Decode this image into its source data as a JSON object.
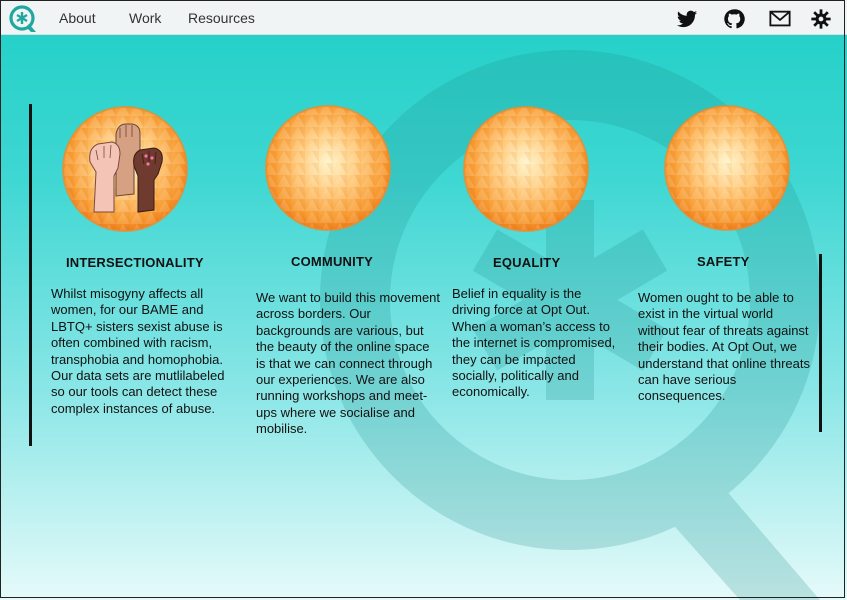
{
  "brand": {
    "logo_icon": "opt-out-asterisk-logo-icon",
    "accent": "#1fa7a0"
  },
  "nav": {
    "links": [
      {
        "label": "About"
      },
      {
        "label": "Work"
      },
      {
        "label": "Resources"
      }
    ],
    "icons": [
      "twitter-icon",
      "github-icon",
      "mail-icon",
      "settings-icon"
    ]
  },
  "values": [
    {
      "title": "INTERSECTIONALITY",
      "text": "Whilst misogyny affects all women, for our BAME and LBTQ+ sisters sexist abuse is often combined with racism, transphobia and homophobia.",
      "text2": "Our data sets are mutlilabeled so our tools can detect these complex instances of abuse.",
      "image": "raised-fists-image"
    },
    {
      "title": "COMMUNITY",
      "text": "We want to build this movement across borders. Our backgrounds are various, but the beauty of the online space is that we can connect through our experiences. We are also running workshops and meet-ups where we socialise and mobilise.",
      "image": "orange-sphere-image"
    },
    {
      "title": "EQUALITY",
      "text": "Belief in equality is the driving force at Opt Out. When a woman’s access to the internet is compromised, they can be impacted socially, politically and economically.",
      "image": "orange-sphere-image"
    },
    {
      "title": "SAFETY",
      "text": "Women ought to be able to exist in the virtual world without fear of threats against their bodies. At Opt Out, we understand that online threats can have serious consequences.",
      "image": "orange-sphere-image"
    }
  ],
  "colors": {
    "sphere": "#f7a23a",
    "teal_top": "#1fcfc6",
    "teal_bottom": "#e6fafa"
  }
}
